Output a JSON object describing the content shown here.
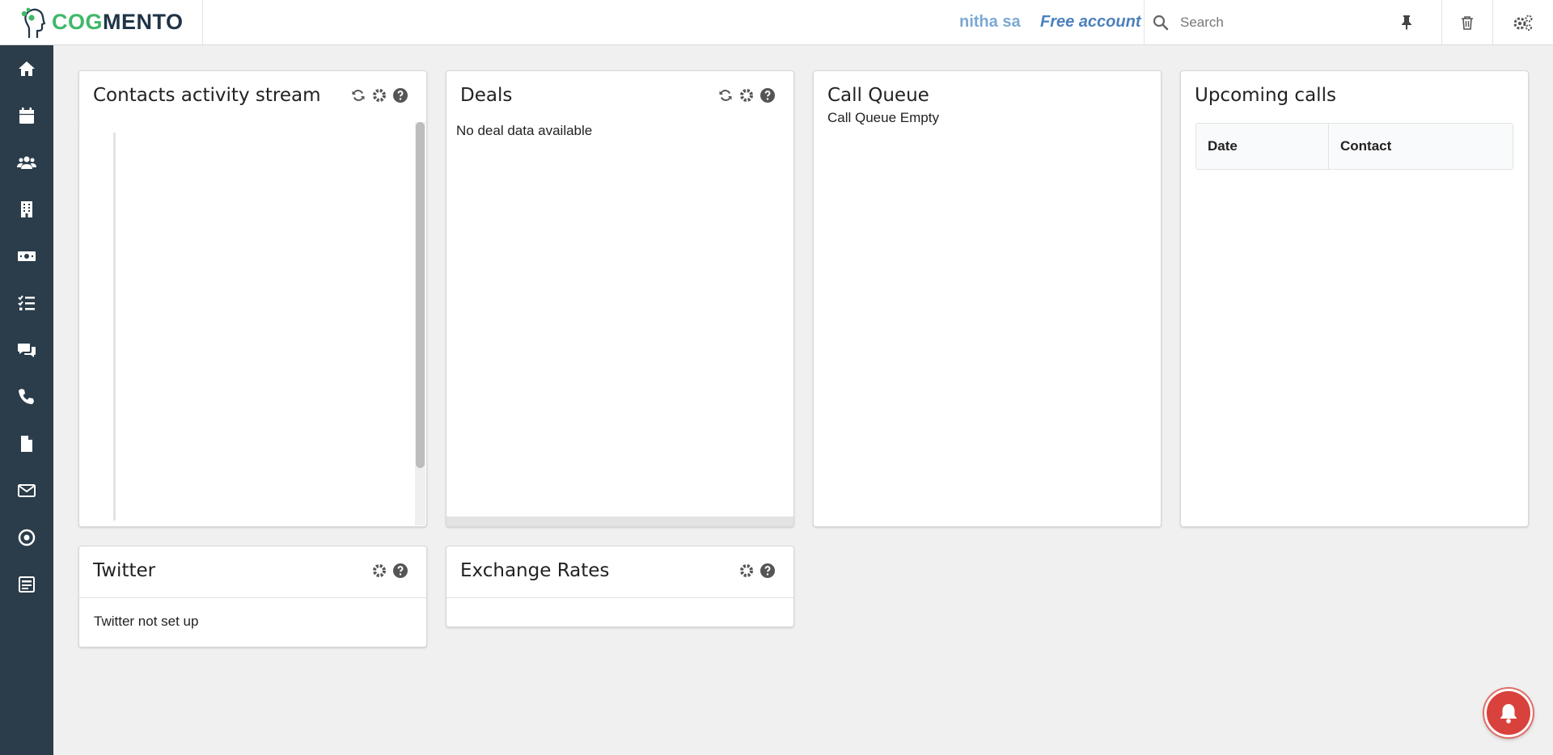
{
  "header": {
    "logo_text_cog": "COG",
    "logo_text_mento": "MENTO",
    "user_name": "nitha sa",
    "account_type": "Free account",
    "search_placeholder": "Search"
  },
  "sidebar": {
    "items": [
      {
        "icon": "home-icon"
      },
      {
        "icon": "calendar-icon"
      },
      {
        "icon": "contacts-icon"
      },
      {
        "icon": "companies-icon"
      },
      {
        "icon": "deals-icon"
      },
      {
        "icon": "tasks-icon"
      },
      {
        "icon": "cases-icon"
      },
      {
        "icon": "calls-icon"
      },
      {
        "icon": "documents-icon"
      },
      {
        "icon": "email-icon"
      },
      {
        "icon": "campaigns-icon"
      },
      {
        "icon": "forms-icon"
      }
    ]
  },
  "widgets": {
    "activity": {
      "title": "Contacts activity stream"
    },
    "deals": {
      "title": "Deals",
      "empty_text": "No deal data available"
    },
    "call_queue": {
      "title": "Call Queue",
      "empty_text": "Call Queue Empty"
    },
    "upcoming": {
      "title": "Upcoming calls",
      "columns": [
        "Date",
        "Contact"
      ]
    },
    "twitter": {
      "title": "Twitter",
      "empty_text": "Twitter not set up"
    },
    "exchange": {
      "title": "Exchange Rates"
    }
  },
  "colors": {
    "sidebar_bg": "#2b3c4a",
    "brand_green": "#3fb868",
    "brand_dark": "#1f3447",
    "user_name": "#7aa9d4",
    "account_link": "#4b80bd",
    "notification": "#d9413c"
  }
}
